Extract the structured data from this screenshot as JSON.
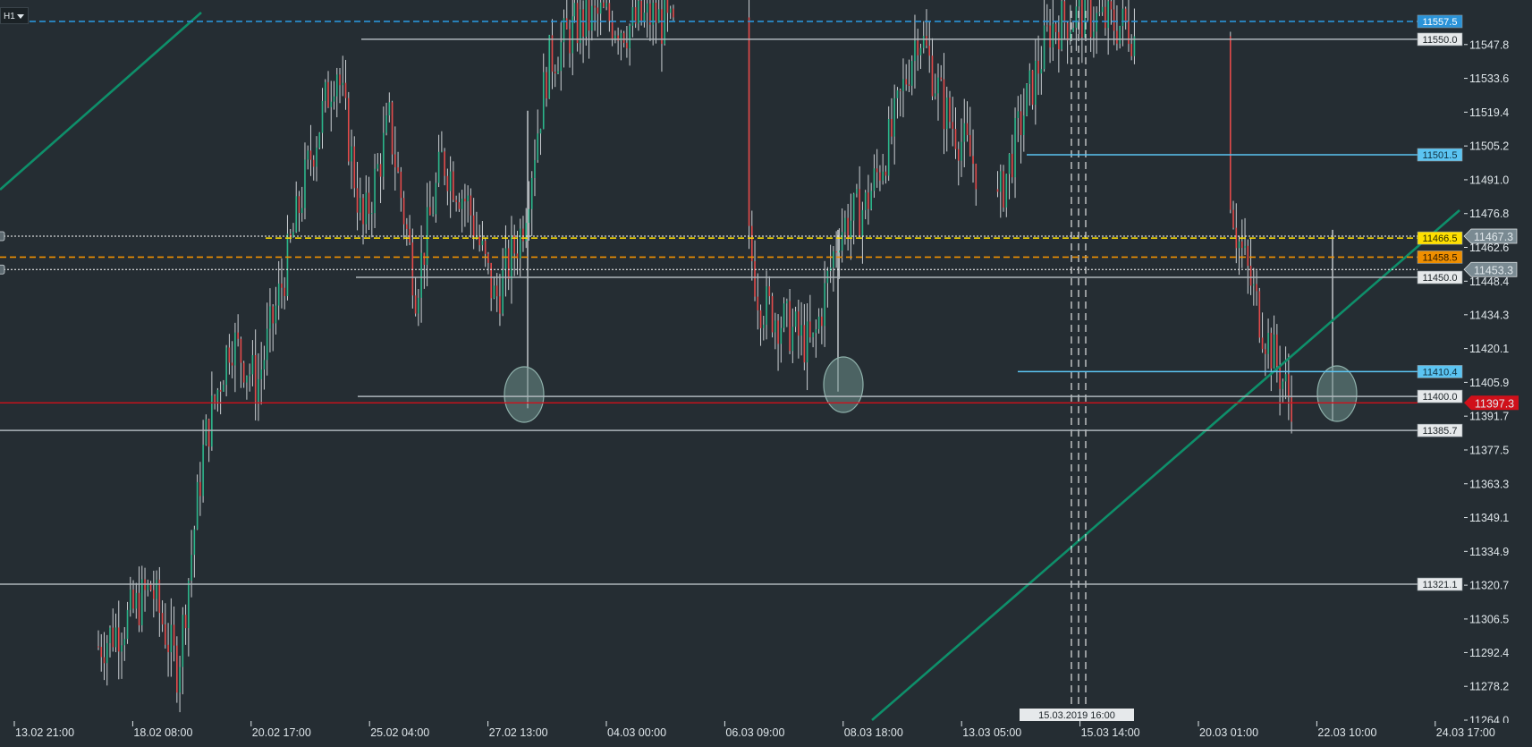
{
  "toolbar": {
    "timeframe": "H1"
  },
  "colors": {
    "background": "#252d33",
    "candle_up": "#2bb58a",
    "candle_down": "#e34a4a",
    "wick": "#e8ecef",
    "trendline": "#0e8f6a",
    "hline_grey": "#aeb6bb",
    "hline_blue": "#5bc4f2",
    "hline_yellow": "#ffe000",
    "hline_orange": "#ef8f00",
    "hline_red": "#d0101a",
    "hline_dash_blue": "#2a93d8",
    "highlight": "#6e8f8a"
  },
  "chart_data": {
    "type": "candlestick",
    "instrument_timeframe": "H1",
    "ylim": [
      11264.0,
      11562.0
    ],
    "y_ticks": [
      "11547.8",
      "11533.6",
      "11519.4",
      "11505.2",
      "11491.0",
      "11476.8",
      "11462.6",
      "11448.4",
      "11434.3",
      "11420.1",
      "11405.9",
      "11391.7",
      "11377.5",
      "11363.3",
      "11349.1",
      "11334.9",
      "11320.7",
      "11306.5",
      "11292.4",
      "11278.2",
      "11264.0"
    ],
    "x_ticks": [
      "13.02 21:00",
      "18.02 08:00",
      "20.02 17:00",
      "25.02 04:00",
      "27.02 13:00",
      "04.03 00:00",
      "06.03 09:00",
      "08.03 18:00",
      "13.03 05:00",
      "15.03 14:00",
      "20.03 01:00",
      "22.03 10:00",
      "24.03 17:00"
    ],
    "crosshair_time": "15.03.2019 16:00",
    "current_price": "11397.3",
    "price_series_close": [
      [
        0.0,
        11295
      ],
      [
        0.5,
        11305
      ],
      [
        1.0,
        11320
      ],
      [
        1.5,
        11285
      ],
      [
        2.0,
        11380
      ],
      [
        2.5,
        11425
      ],
      [
        3.0,
        11405
      ],
      [
        3.5,
        11450
      ],
      [
        4.0,
        11500
      ],
      [
        4.5,
        11540
      ],
      [
        5.0,
        11470
      ],
      [
        5.5,
        11515
      ],
      [
        6.0,
        11445
      ],
      [
        6.5,
        11500
      ],
      [
        7.0,
        11480
      ],
      [
        7.5,
        11440
      ],
      [
        8.0,
        11470
      ],
      [
        8.5,
        11540
      ],
      [
        9.0,
        11555
      ],
      [
        9.5,
        11560
      ],
      [
        10.0,
        11555
      ],
      [
        10.5,
        11560
      ],
      [
        11.0,
        11550
      ],
      [
        11.5,
        11510
      ],
      [
        12.0,
        11500
      ],
      [
        12.5,
        11440
      ],
      [
        13.0,
        11430
      ],
      [
        13.5,
        11420
      ],
      [
        14.0,
        11470
      ],
      [
        14.5,
        11480
      ],
      [
        15.0,
        11510
      ],
      [
        15.5,
        11555
      ],
      [
        16.0,
        11520
      ],
      [
        16.5,
        11500
      ],
      [
        17.0,
        11480
      ],
      [
        17.5,
        11520
      ],
      [
        18.0,
        11555
      ],
      [
        18.5,
        11560
      ],
      [
        19.5,
        11555
      ],
      [
        20.0,
        11530
      ],
      [
        20.5,
        11500
      ],
      [
        21.0,
        11555
      ],
      [
        21.5,
        11470
      ],
      [
        22.0,
        11430
      ],
      [
        22.5,
        11400
      ]
    ],
    "horizontal_levels": [
      {
        "value": 11557.5,
        "label": "11557.5",
        "style": "dashed",
        "color_key": "hline_dash_blue",
        "tag_bg": "#2a93d8",
        "tag_fg": "#ffffff"
      },
      {
        "value": 11550.0,
        "label": "11550.0",
        "style": "solid",
        "color_key": "hline_grey",
        "tag_bg": "#e6e9eb",
        "tag_fg": "#1d2428"
      },
      {
        "value": 11501.5,
        "label": "11501.5",
        "style": "solid",
        "color_key": "hline_blue",
        "tag_bg": "#5bc4f2",
        "tag_fg": "#10303f"
      },
      {
        "value": 11466.5,
        "label": "11466.5",
        "style": "dashed",
        "color_key": "hline_yellow",
        "tag_bg": "#ffe000",
        "tag_fg": "#2b2b00"
      },
      {
        "value": 11458.5,
        "label": "11458.5",
        "style": "dashed",
        "color_key": "hline_orange",
        "tag_bg": "#ef8f00",
        "tag_fg": "#2b1800"
      },
      {
        "value": 11450.0,
        "label": "11450.0",
        "style": "solid",
        "color_key": "hline_grey",
        "tag_bg": "#e6e9eb",
        "tag_fg": "#1d2428"
      },
      {
        "value": 11410.4,
        "label": "11410.4",
        "style": "solid",
        "color_key": "hline_blue",
        "tag_bg": "#5bc4f2",
        "tag_fg": "#10303f"
      },
      {
        "value": 11400.0,
        "label": "11400.0",
        "style": "solid",
        "color_key": "hline_grey",
        "tag_bg": "#e6e9eb",
        "tag_fg": "#1d2428"
      },
      {
        "value": 11385.7,
        "label": "11385.7",
        "style": "solid",
        "color_key": "hline_grey",
        "tag_bg": "#e6e9eb",
        "tag_fg": "#1d2428"
      },
      {
        "value": 11321.1,
        "label": "11321.1",
        "style": "solid",
        "color_key": "hline_grey",
        "tag_bg": "#e6e9eb",
        "tag_fg": "#1d2428"
      }
    ],
    "marker_levels": [
      {
        "value": 11467.3,
        "label": "11467.3"
      },
      {
        "value": 11453.3,
        "label": "11453.3"
      }
    ]
  }
}
